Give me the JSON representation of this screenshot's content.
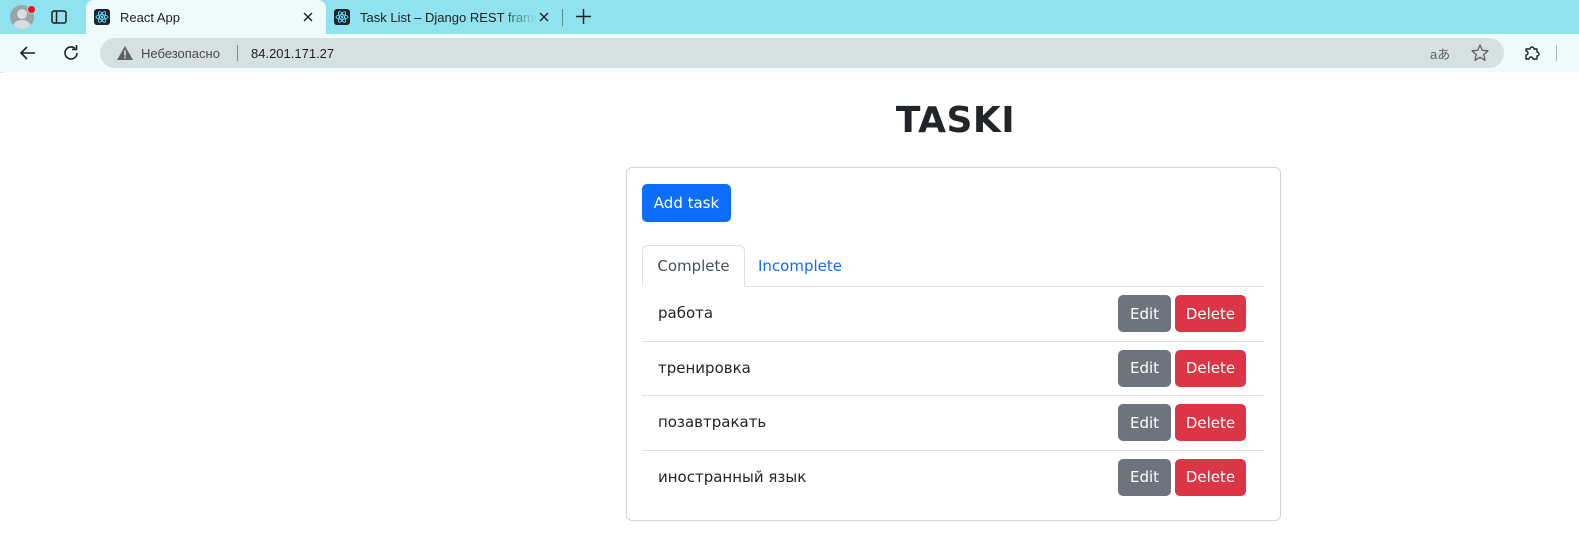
{
  "browser": {
    "tabs": [
      {
        "title": "React App",
        "active": true,
        "icon": "react-icon"
      },
      {
        "title": "Task List – Django REST framework",
        "active": false,
        "icon": "react-icon"
      }
    ],
    "address_bar": {
      "security_label": "Небезопасно",
      "url": "84.201.171.27"
    },
    "translate_glyph": "aあ",
    "icons": {
      "back": "arrow-left-icon",
      "reload": "reload-icon",
      "favorite": "star-icon",
      "extensions": "puzzle-icon",
      "new_tab": "plus-icon",
      "close": "close-icon"
    }
  },
  "app": {
    "title": "TASKI",
    "add_task_label": "Add task",
    "tabs": [
      {
        "label": "Complete",
        "active": true
      },
      {
        "label": "Incomplete",
        "active": false
      }
    ],
    "tasks": [
      {
        "label": "работа"
      },
      {
        "label": "тренировка"
      },
      {
        "label": "позавтракать"
      },
      {
        "label": "иностранный язык"
      }
    ],
    "edit_label": "Edit",
    "delete_label": "Delete",
    "colors": {
      "primary": "#0d6efd",
      "secondary": "#6c757d",
      "danger": "#dc3545",
      "tab_strip": "#8fe3ee"
    }
  }
}
